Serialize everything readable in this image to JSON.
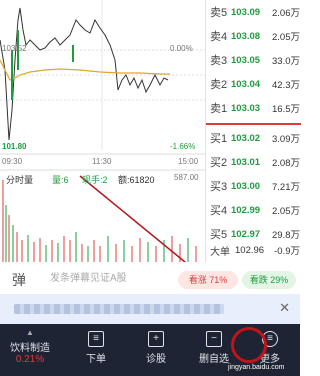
{
  "chart": {
    "price_high": "103.52",
    "price_low": "101.80",
    "pct_high": "0.00%",
    "pct_low": "-1.66%",
    "time_start": "09:30",
    "time_mid": "11:30",
    "time_end": "15:00",
    "tab_label": "分时量",
    "vol_label": "量:6",
    "hand_label": "现手:2",
    "amount_label": "额:61820",
    "vol_max": "587.00"
  },
  "order_book": {
    "asks": [
      {
        "side": "卖5",
        "price": "103.09",
        "vol": "2.06万"
      },
      {
        "side": "卖4",
        "price": "103.08",
        "vol": "2.05万"
      },
      {
        "side": "卖3",
        "price": "103.05",
        "vol": "33.0万"
      },
      {
        "side": "卖2",
        "price": "103.04",
        "vol": "42.3万"
      },
      {
        "side": "卖1",
        "price": "103.03",
        "vol": "16.5万"
      }
    ],
    "bids": [
      {
        "side": "买1",
        "price": "103.02",
        "vol": "3.09万"
      },
      {
        "side": "买2",
        "price": "103.01",
        "vol": "2.08万"
      },
      {
        "side": "买3",
        "price": "103.00",
        "vol": "7.21万"
      },
      {
        "side": "买4",
        "price": "102.99",
        "vol": "2.05万"
      },
      {
        "side": "买5",
        "price": "102.97",
        "vol": "29.8万"
      }
    ],
    "big_order": {
      "label": "大单",
      "price": "102.96",
      "vol": "-0.9万"
    }
  },
  "danmu": {
    "icon": "弹",
    "placeholder": "发条弹幕见证A股",
    "up_label": "看涨 71%",
    "down_label": "看跌 29%"
  },
  "tabbar": {
    "stock_name": "饮料制造",
    "stock_change": "0.21%",
    "items": [
      "下单",
      "诊股",
      "删自选",
      "更多"
    ]
  },
  "watermark": "jingyan.baidu.com"
}
